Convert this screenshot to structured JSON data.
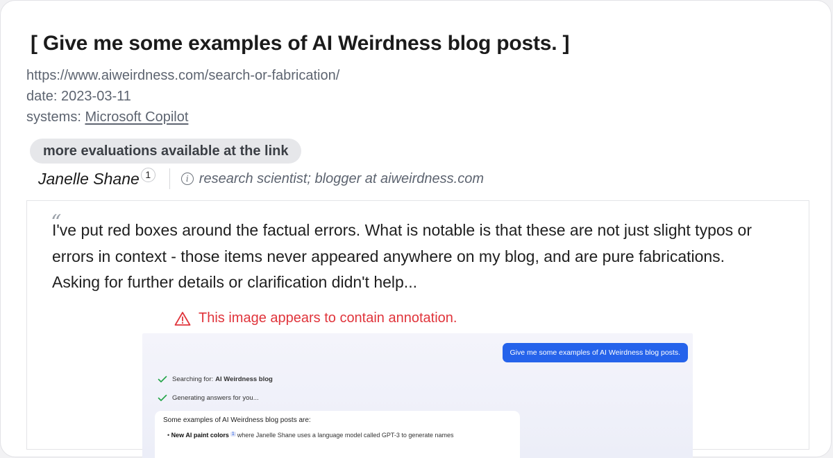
{
  "entry": {
    "title": "[ Give me some examples of AI Weirdness blog posts. ]",
    "url": "https://www.aiweirdness.com/search-or-fabrication/",
    "date_text": "date: 2023-03-11",
    "systems_prefix": "systems:",
    "system_link": "Microsoft Copilot",
    "more_evaluations_label": "more evaluations available at the link"
  },
  "author": {
    "name": "Janelle Shane",
    "reference_number": "1",
    "role": "research scientist; blogger at aiweirdness.com"
  },
  "quote": {
    "mark": "“",
    "text": "I've put red boxes around the factual errors. What is notable is that these are not just slight typos or errors in context - those items never appeared anywhere on my blog, and are pure fabrications. Asking for further details or clarification didn't help...",
    "annotation_warning": "This image appears to contain annotation."
  },
  "embedded_screenshot": {
    "user_prompt": "Give me some examples of AI Weirdness blog posts.",
    "step1_prefix": "Searching for:",
    "step1_query": "AI Weirdness blog",
    "step2": "Generating answers for you...",
    "answer_intro": "Some examples of AI Weirdness blog posts are:",
    "answer_item_title": "New AI paint colors",
    "answer_item_ref": "1",
    "answer_item_text": "where Janelle Shane uses a language model called GPT-3 to generate names"
  },
  "colors": {
    "warning": "#e0343b",
    "prompt_bubble": "#2563eb",
    "check": "#22a447"
  }
}
